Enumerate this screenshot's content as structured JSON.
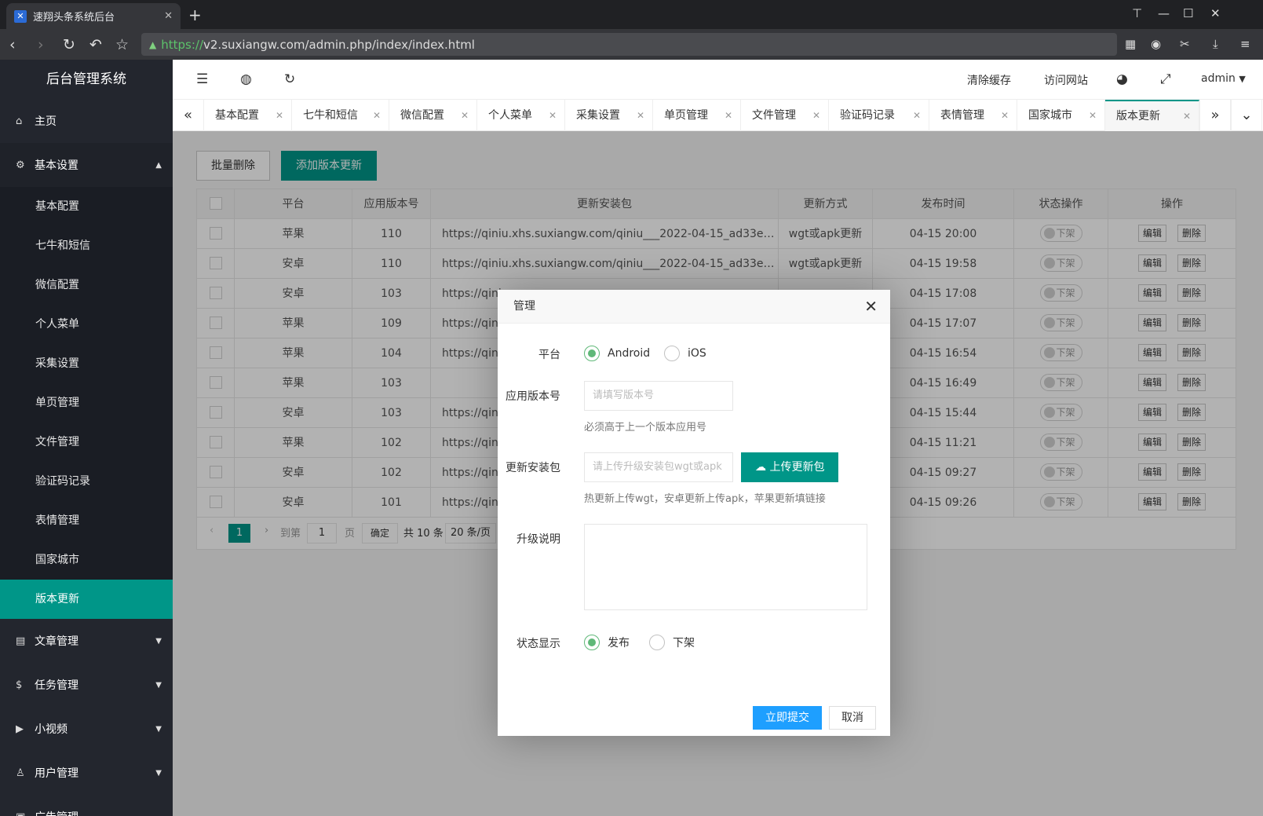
{
  "browser": {
    "tab_title": "速翔头条系统后台",
    "tab_close": "✕",
    "new_tab": "+",
    "url_scheme": "https://",
    "url_rest": "v2.suxiangw.com/admin.php/index/index.html",
    "win_pin": "⊤",
    "win_min": "—",
    "win_max": "☐",
    "win_close": "✕"
  },
  "sidebar": {
    "logo": "后台管理系统",
    "home": "主页",
    "basic_settings": "基本设置",
    "sub_items": [
      "基本配置",
      "七牛和短信",
      "微信配置",
      "个人菜单",
      "采集设置",
      "单页管理",
      "文件管理",
      "验证码记录",
      "表情管理",
      "国家城市",
      "版本更新"
    ],
    "article": "文章管理",
    "task": "任务管理",
    "video": "小视频",
    "users": "用户管理",
    "ads": "广告管理"
  },
  "header": {
    "clear_cache": "清除缓存",
    "visit_site": "访问网站",
    "user": "admin"
  },
  "tabs": [
    "基本配置",
    "七牛和短信",
    "微信配置",
    "个人菜单",
    "采集设置",
    "单页管理",
    "文件管理",
    "验证码记录",
    "表情管理",
    "国家城市",
    "版本更新"
  ],
  "toolbar": {
    "batch_delete": "批量删除",
    "add_version": "添加版本更新"
  },
  "table": {
    "headers": [
      "平台",
      "应用版本号",
      "更新安装包",
      "更新方式",
      "发布时间",
      "状态操作",
      "操作"
    ],
    "status_label": "下架",
    "edit": "编辑",
    "delete": "删除",
    "rows": [
      {
        "platform": "苹果",
        "version": "110",
        "package": "https://qiniu.xhs.suxiangw.com/qiniu___2022-04-15_ad33e4e9cc...",
        "method": "wgt或apk更新",
        "time": "04-15 20:00"
      },
      {
        "platform": "安卓",
        "version": "110",
        "package": "https://qiniu.xhs.suxiangw.com/qiniu___2022-04-15_ad33e4e9cc...",
        "method": "wgt或apk更新",
        "time": "04-15 19:58"
      },
      {
        "platform": "安卓",
        "version": "103",
        "package": "https://qiniu",
        "method": "",
        "time": "04-15 17:08"
      },
      {
        "platform": "苹果",
        "version": "109",
        "package": "https://qiniu",
        "method": "",
        "time": "04-15 17:07"
      },
      {
        "platform": "苹果",
        "version": "104",
        "package": "https://qiniu",
        "method": "",
        "time": "04-15 16:54"
      },
      {
        "platform": "苹果",
        "version": "103",
        "package": "",
        "method": "",
        "time": "04-15 16:49"
      },
      {
        "platform": "安卓",
        "version": "103",
        "package": "https://qiniu",
        "method": "",
        "time": "04-15 15:44"
      },
      {
        "platform": "苹果",
        "version": "102",
        "package": "https://qiniu",
        "method": "",
        "time": "04-15 11:21"
      },
      {
        "platform": "安卓",
        "version": "102",
        "package": "https://qiniu",
        "method": "",
        "time": "04-15 09:27"
      },
      {
        "platform": "安卓",
        "version": "101",
        "package": "https://qiniu",
        "method": "",
        "time": "04-15 09:26"
      }
    ]
  },
  "pager": {
    "current": "1",
    "goto": "到第",
    "page_input": "1",
    "page": "页",
    "confirm": "确定",
    "total": "共 10 条",
    "per_page": "20 条/页"
  },
  "modal": {
    "title": "管理",
    "platform_label": "平台",
    "android": "Android",
    "ios": "iOS",
    "version_label": "应用版本号",
    "version_placeholder": "请填写版本号",
    "version_hint": "必须高于上一个版本应用号",
    "package_label": "更新安装包",
    "package_placeholder": "请上传升级安装包wgt或apk",
    "upload_button": "上传更新包",
    "package_hint": "热更新上传wgt，安卓更新上传apk，苹果更新填链接",
    "notes_label": "升级说明",
    "status_label": "状态显示",
    "publish": "发布",
    "offline": "下架",
    "submit": "立即提交",
    "cancel": "取消"
  }
}
